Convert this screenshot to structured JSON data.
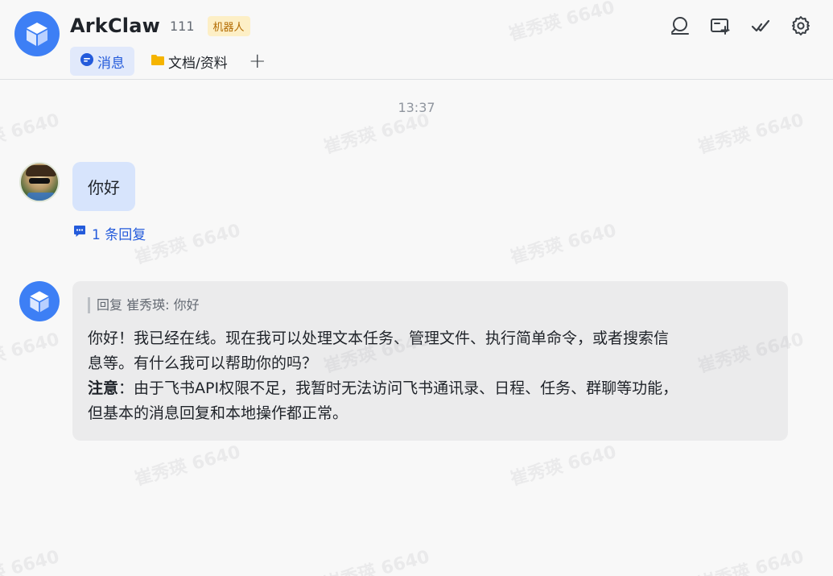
{
  "header": {
    "title": "ArkClaw",
    "member_count": "111",
    "bot_badge": "机器人",
    "tabs": [
      {
        "label": "消息",
        "icon": "chat-bubble-icon",
        "active": true
      },
      {
        "label": "文档/资料",
        "icon": "folder-icon",
        "active": false
      }
    ],
    "add_tab_label": "+",
    "tools": [
      "search-icon",
      "add-screen-icon",
      "check-icon",
      "settings-icon"
    ]
  },
  "messages": {
    "time_divider": "13:37",
    "user_message": {
      "text": "你好",
      "reply_count_label": "1 条回复"
    },
    "bot_message": {
      "quote": "回复 崔秀瑛: 你好",
      "line1": "你好！我已经在线。现在我可以处理文本任务、管理文件、执行简单命令，或者搜索信",
      "line2": "息等。有什么我可以帮助你的吗？",
      "note_label": "注意",
      "note_text": "：由于飞书API权限不足，我暂时无法访问飞书通讯录、日程、任务、群聊等功能，",
      "line4": "但基本的消息回复和本地操作都正常。"
    }
  },
  "watermark_text": "崔秀瑛 6640",
  "colors": {
    "accent": "#245bdb",
    "bot_avatar": "#3d7ff5",
    "user_bubble": "#d7e4fc",
    "bot_bubble": "#ebebec",
    "badge_bg": "#fdefc6",
    "badge_text": "#b26a00"
  }
}
